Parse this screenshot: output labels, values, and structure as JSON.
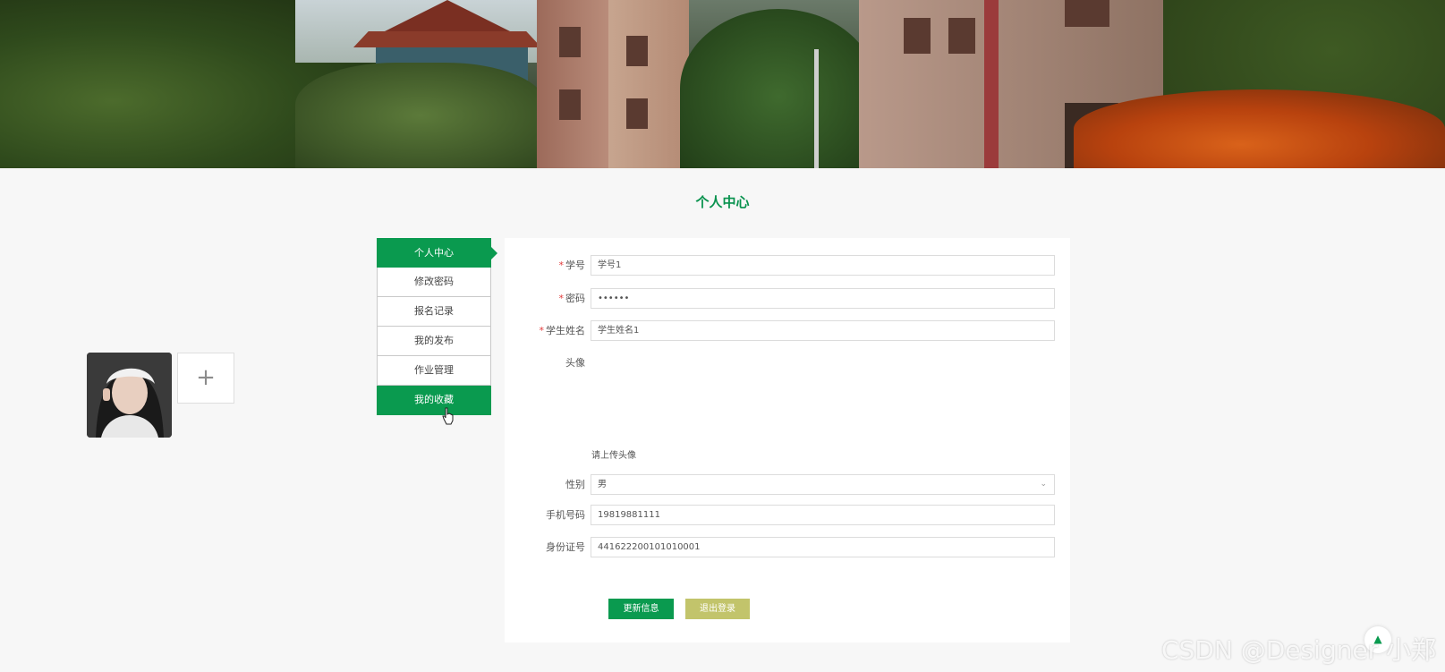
{
  "page": {
    "title": "个人中心"
  },
  "side_menu": {
    "items": [
      {
        "label": "个人中心",
        "state": "active"
      },
      {
        "label": "修改密码",
        "state": "normal"
      },
      {
        "label": "报名记录",
        "state": "normal"
      },
      {
        "label": "我的发布",
        "state": "normal"
      },
      {
        "label": "作业管理",
        "state": "normal"
      },
      {
        "label": "我的收藏",
        "state": "hover"
      }
    ]
  },
  "form": {
    "student_id": {
      "label": "学号",
      "required": true,
      "value": "学号1"
    },
    "password": {
      "label": "密码",
      "required": true,
      "value": "••••••"
    },
    "student_name": {
      "label": "学生姓名",
      "required": true,
      "value": "学生姓名1"
    },
    "avatar": {
      "label": "头像",
      "upload_icon": "+",
      "hint": "请上传头像"
    },
    "gender": {
      "label": "性别",
      "value": "男",
      "icon": "chevron-down-icon"
    },
    "phone": {
      "label": "手机号码",
      "value": "19819881111"
    },
    "id_card": {
      "label": "身份证号",
      "value": "441622200101010001"
    }
  },
  "actions": {
    "update_label": "更新信息",
    "logout_label": "退出登录"
  },
  "watermark": {
    "text": "CSDN @Designer 小郑"
  },
  "colors": {
    "accent": "#0a9a4f",
    "logout_button": "#c2c46b",
    "required_star": "#e23b3b"
  }
}
